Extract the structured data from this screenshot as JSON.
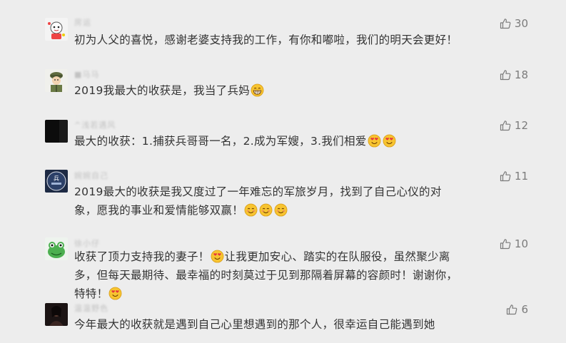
{
  "colors": {
    "background": "#ededed",
    "text": "#333333",
    "nickname": "#c2c2c2",
    "like": "#7b7b7b"
  },
  "comments": [
    {
      "nickname": "房运",
      "avatar_icon": "cartoon-avatar-icon",
      "text": "初为人父的喜悦，感谢老婆支持我的工作，有你和嘟啦，我们的明天会更好！",
      "emojis": [],
      "likes": "30"
    },
    {
      "nickname": "■马马",
      "avatar_icon": "soldier-avatar-icon",
      "text": "2019我最大的收获是，我当了兵妈",
      "emojis": [
        "grin-emoji"
      ],
      "likes": "18"
    },
    {
      "nickname": "^浅若遇风",
      "avatar_icon": "dark-avatar-icon",
      "text": "最大的收获：1.捕获兵哥哥一名，2.成为军嫂，3.我们相爱",
      "emojis": [
        "heart-eyes-emoji",
        "heart-eyes-emoji"
      ],
      "likes": "12"
    },
    {
      "nickname": "婉婉自己",
      "avatar_icon": "badge-avatar-icon",
      "text": "2019最大的收获是我又度过了一年难忘的军旅岁月，找到了自己心仪的对象，愿我的事业和爱情能够双赢！",
      "emojis": [
        "blush-emoji",
        "blush-emoji",
        "blush-emoji"
      ],
      "likes": "11"
    },
    {
      "nickname": "徐小仔",
      "avatar_icon": "frog-avatar-icon",
      "text_parts": [
        "收获了顶力支持我的妻子！",
        "让我更加安心、踏实的在队服役，虽然聚少离多，但每天最期待、最幸福的时刻莫过于见到那隔着屏幕的容颜时！谢谢你，特特！"
      ],
      "emojis": [
        "heart-eyes-emoji",
        "heart-eyes-emoji"
      ],
      "likes": "10"
    },
    {
      "nickname": "温温野色",
      "avatar_icon": "photo-avatar-icon",
      "text": "今年最大的收获就是遇到自己心里想遇到的那个人，很幸运自己能遇到她",
      "emojis": [],
      "likes": "6"
    }
  ]
}
